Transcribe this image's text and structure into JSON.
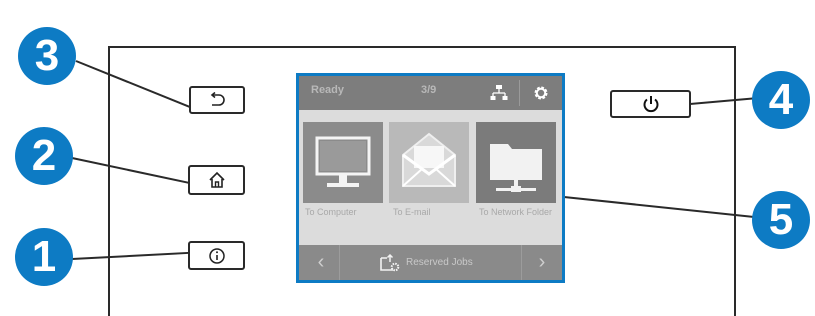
{
  "callouts": [
    "3",
    "2",
    "1",
    "4",
    "5"
  ],
  "buttons": {
    "back": {
      "icon": "back-arrow-icon"
    },
    "home": {
      "icon": "home-icon"
    },
    "info": {
      "icon": "info-icon"
    },
    "power": {
      "icon": "power-icon"
    }
  },
  "screen": {
    "status": {
      "title": "Ready",
      "page": "3/9",
      "icons": [
        "network-icon",
        "settings-gear-icon"
      ]
    },
    "tiles": [
      {
        "label": "To Computer",
        "icon": "computer-monitor-icon"
      },
      {
        "label": "To E-mail",
        "icon": "email-envelope-icon"
      },
      {
        "label": "To Network Folder",
        "icon": "network-folder-icon"
      }
    ],
    "bottom": {
      "label": "Reserved Jobs",
      "icon": "reserved-jobs-icon"
    }
  },
  "colors": {
    "accent": "#0d7bc4",
    "frame": "#2a2a2a",
    "status_bar": "#7d7d7d",
    "tile_dark": "#8b8b8b",
    "tile_light": "#b9b9b9"
  }
}
